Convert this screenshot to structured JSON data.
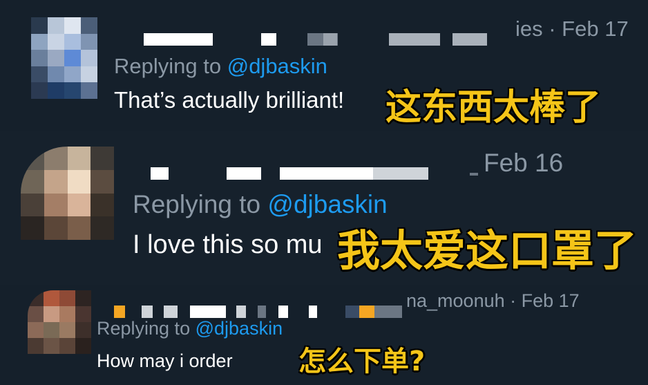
{
  "tweets": [
    {
      "meta": "ies · Feb 17",
      "reply_prefix": "Replying to",
      "mention": "@djbaskin",
      "text": "That’s actually brilliant!",
      "caption_zh": "这东西太棒了"
    },
    {
      "meta": "Feb 16",
      "reply_prefix": "Replying to",
      "mention": "@djbaskin",
      "text": "I love this so mu",
      "caption_zh": "我太爱这口罩了"
    },
    {
      "meta": "na_moonuh · Feb 17",
      "reply_prefix": "Replying to",
      "mention": "@djbaskin",
      "text": "How may i order",
      "caption_zh": "怎么下单?"
    }
  ],
  "colors": {
    "background": "#15202b",
    "muted": "#8b98a5",
    "mention": "#1d9bf0",
    "caption": "#f5c518"
  }
}
